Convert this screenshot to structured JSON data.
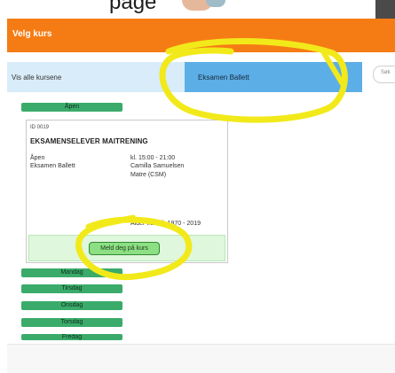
{
  "top_caption": "page",
  "header": {
    "title": "Velg kurs"
  },
  "tabs": {
    "all": "Vis alle kursene",
    "exam": "Eksamen Ballett"
  },
  "search": {
    "label": "Søk"
  },
  "status_pill": "Åpen",
  "course": {
    "id": "ID 0019",
    "name": "EKSAMENSELEVER MAITRENING",
    "status": "Åpen",
    "category": "Eksamen Ballett",
    "time": "kl. 15:00 - 21:00",
    "teacher": "Camilla Samuelsen",
    "location": "Matre (CSM)",
    "age": "Alder fra - til: 1970 - 2019",
    "signup_label": "Meld deg på kurs"
  },
  "days": [
    "Mandag",
    "Tirsdag",
    "Onsdag",
    "Torsdag",
    "Fredag"
  ],
  "colors": {
    "header": "#f57c14",
    "tab_active": "#5baee6",
    "pill": "#3aab6a",
    "highlight": "#f2e91a"
  }
}
